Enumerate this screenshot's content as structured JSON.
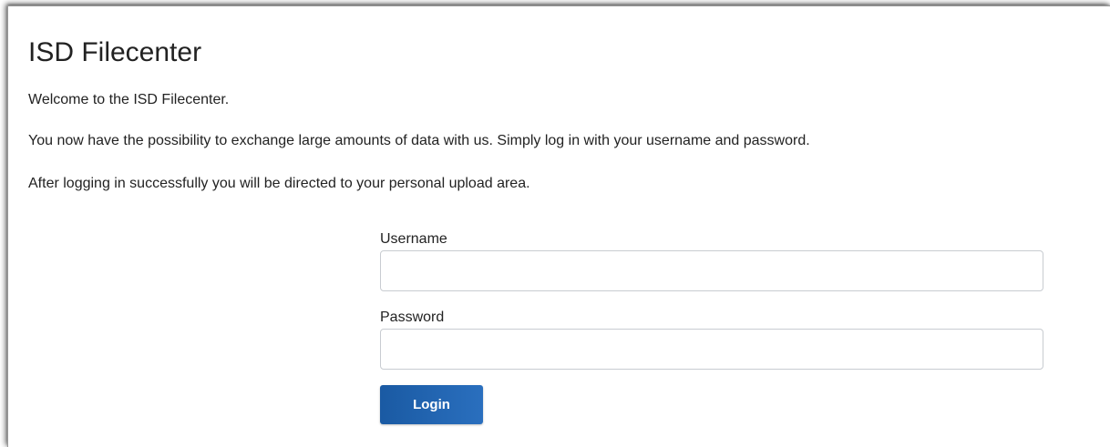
{
  "page": {
    "title": "ISD Filecenter",
    "welcome": "Welcome to the ISD Filecenter.",
    "intro": "You now have the possibility to exchange large amounts of data with us. Simply log in with your username and password.",
    "after_login": "After logging in successfully you will be directed to your personal upload area."
  },
  "login_form": {
    "username_label": "Username",
    "username_value": "",
    "password_label": "Password",
    "password_value": "",
    "login_label": "Login"
  },
  "colors": {
    "button_bg": "#1a5aa3",
    "button_text": "#ffffff",
    "text": "#222222",
    "input_border": "#c8ccd1"
  }
}
